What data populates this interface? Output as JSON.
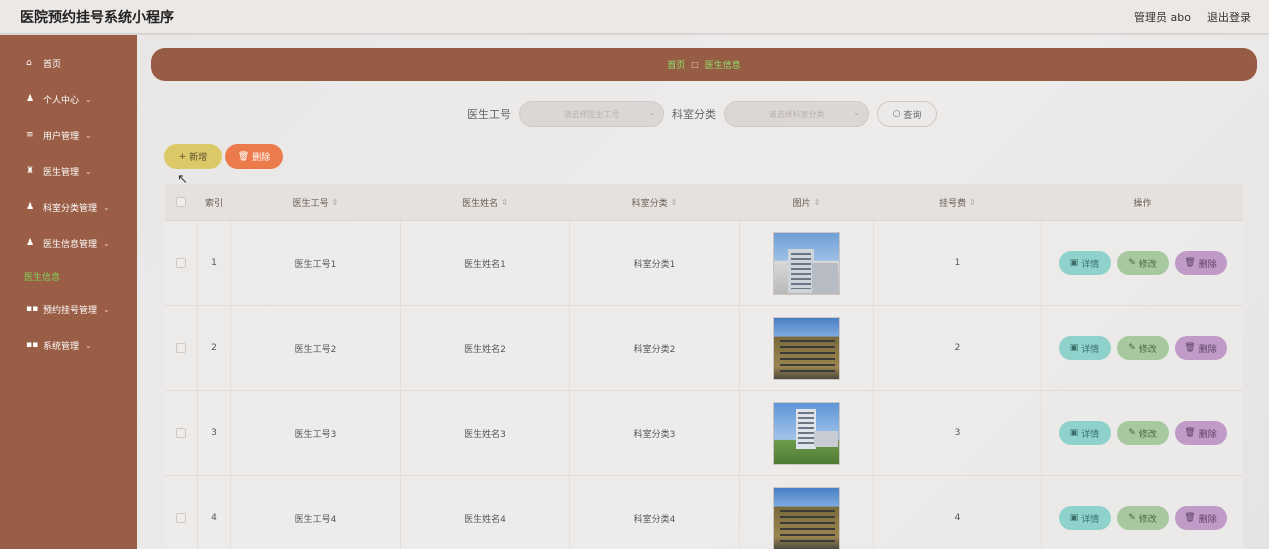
{
  "header": {
    "app_title": "医院预约挂号系统小程序",
    "user_label": "管理员 abo",
    "logout_label": "退出登录"
  },
  "sidebar": {
    "items": [
      {
        "label": "首页",
        "icon": "home-icon",
        "has_children": false
      },
      {
        "label": "个人中心",
        "icon": "user-icon",
        "has_children": true
      },
      {
        "label": "用户管理",
        "icon": "list-icon",
        "has_children": true
      },
      {
        "label": "医生管理",
        "icon": "doctor-icon",
        "has_children": true
      },
      {
        "label": "科室分类管理",
        "icon": "user-icon",
        "has_children": true
      },
      {
        "label": "医生信息管理",
        "icon": "user-icon",
        "has_children": true
      },
      {
        "label": "医生信息",
        "icon": "",
        "has_children": false,
        "active": true
      },
      {
        "label": "预约挂号管理",
        "icon": "grid-icon",
        "has_children": true
      },
      {
        "label": "系统管理",
        "icon": "grid-icon",
        "has_children": true
      }
    ]
  },
  "breadcrumb": {
    "home": "首页",
    "separator": "□",
    "current": "医生信息"
  },
  "search": {
    "doctor_no_label": "医生工号",
    "doctor_no_placeholder": "请选择医生工号",
    "dept_label": "科室分类",
    "dept_placeholder": "请选择科室分类",
    "query_label": "查询"
  },
  "toolbar": {
    "add_label": "新增",
    "delete_label": "删除"
  },
  "table": {
    "headers": {
      "index": "索引",
      "doctor_no": "医生工号",
      "doctor_name": "医生姓名",
      "dept": "科室分类",
      "picture": "图片",
      "fee": "挂号费",
      "ops": "操作"
    },
    "rows": [
      {
        "index": "1",
        "doctor_no": "医生工号1",
        "doctor_name": "医生姓名1",
        "dept": "科室分类1",
        "fee": "1"
      },
      {
        "index": "2",
        "doctor_no": "医生工号2",
        "doctor_name": "医生姓名2",
        "dept": "科室分类2",
        "fee": "2"
      },
      {
        "index": "3",
        "doctor_no": "医生工号3",
        "doctor_name": "医生姓名3",
        "dept": "科室分类3",
        "fee": "3"
      },
      {
        "index": "4",
        "doctor_no": "医生工号4",
        "doctor_name": "医生姓名4",
        "dept": "科室分类4",
        "fee": "4"
      }
    ],
    "op_labels": {
      "detail": "详情",
      "edit": "修改",
      "delete": "删除"
    }
  },
  "colors": {
    "sidebar": "#9a5d45",
    "breadcrumb": "#975d44",
    "active_green": "#7fd35a",
    "add_button": "#dbc968",
    "delete_button": "#ec7b4b",
    "detail_button": "#8fd2cc",
    "edit_button": "#a8c9a0",
    "row_delete_button": "#c09bc8"
  }
}
